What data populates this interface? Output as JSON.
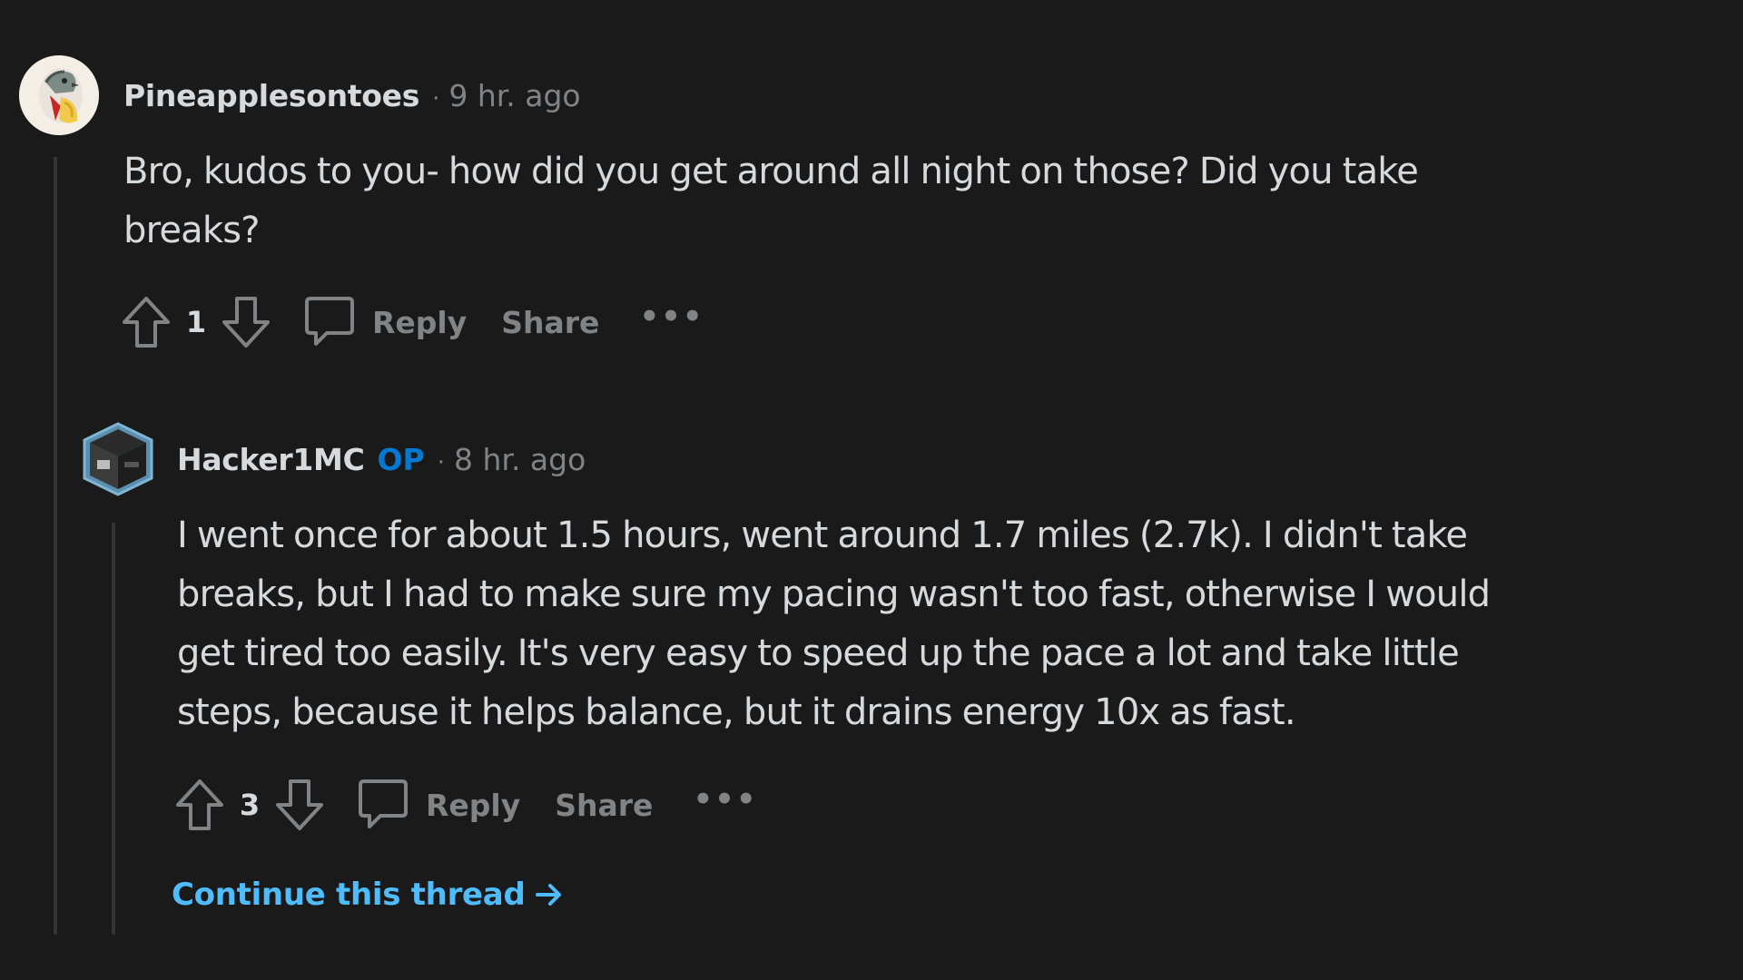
{
  "comments": [
    {
      "username": "Pineapplesontoes",
      "op_badge": "",
      "separator": "·",
      "time": "9 hr. ago",
      "body_lines": [
        "Bro, kudos to you- how did you get around all night on those? Did you take",
        "breaks?"
      ],
      "votes": "1",
      "reply_label": "Reply",
      "share_label": "Share",
      "more_label": "•••",
      "avatar_icon": "pigeon-avatar"
    },
    {
      "username": "Hacker1MC",
      "op_badge": "OP",
      "separator": "·",
      "time": "8 hr. ago",
      "body_lines": [
        "I went once for about 1.5 hours, went around 1.7 miles (2.7k). I didn't take",
        "breaks, but I had to make sure my pacing wasn't too fast, otherwise I would",
        "get tired too easily. It's very easy to speed up the pace a lot and take little",
        "steps, because it helps balance, but it drains energy 10x as fast."
      ],
      "votes": "3",
      "reply_label": "Reply",
      "share_label": "Share",
      "more_label": "•••",
      "avatar_icon": "cube-avatar"
    }
  ],
  "continue_thread": {
    "label": "Continue this thread",
    "icon": "arrow-right-icon"
  },
  "colors": {
    "background": "#1a1a1b",
    "text": "#d7dadc",
    "muted": "#818384",
    "op": "#0079d3",
    "link": "#4fbcff",
    "thread_line": "#343536"
  }
}
